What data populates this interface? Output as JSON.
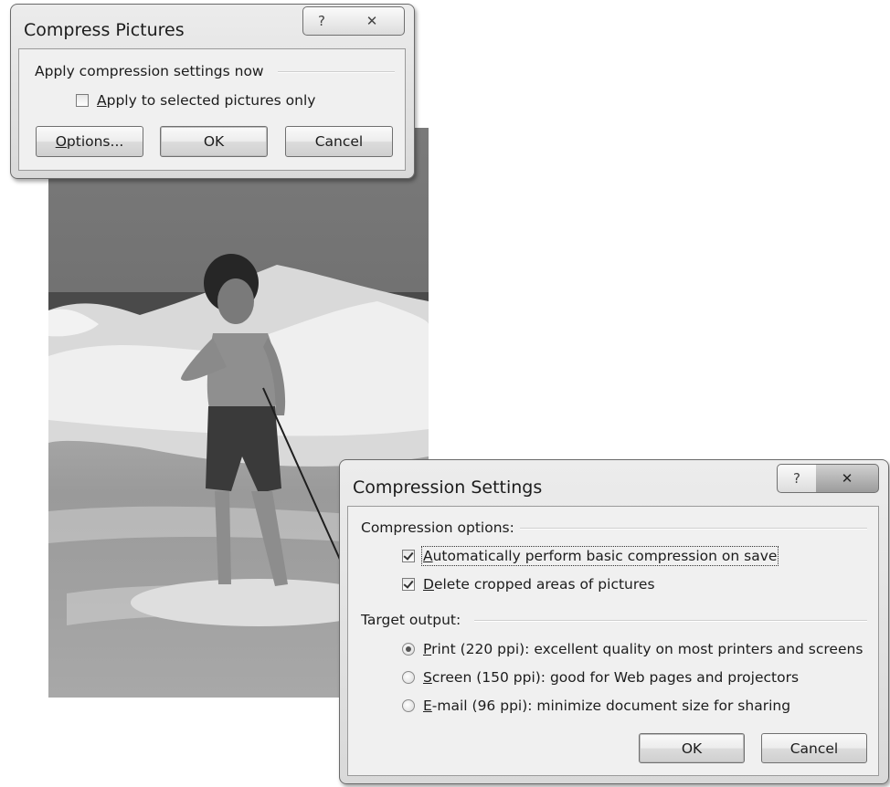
{
  "compress_pictures": {
    "title": "Compress Pictures",
    "help_icon": "question-mark-icon",
    "close_icon": "close-x-icon",
    "group_label": "Apply compression settings now",
    "apply_selected": {
      "label_prefix": "",
      "label_mnemonic": "A",
      "label_rest": "pply to selected pictures only",
      "checked": false
    },
    "buttons": {
      "options": {
        "mnemonic": "O",
        "rest": "ptions..."
      },
      "ok": "OK",
      "cancel": "Cancel"
    }
  },
  "compression_settings": {
    "title": "Compression Settings",
    "help_icon": "question-mark-icon",
    "close_icon": "close-x-icon",
    "options_label": "Compression options:",
    "auto_compress": {
      "mnemonic": "A",
      "rest": "utomatically perform basic compression on save",
      "checked": true
    },
    "delete_cropped": {
      "mnemonic": "D",
      "rest": "elete cropped areas of pictures",
      "checked": true
    },
    "target_label": "Target output:",
    "targets": [
      {
        "mnemonic": "P",
        "rest": "rint (220 ppi): excellent quality on most printers and screens",
        "selected": true
      },
      {
        "mnemonic": "S",
        "rest": "creen (150 ppi): good for Web pages and projectors",
        "selected": false
      },
      {
        "mnemonic": "E",
        "rest": "-mail (96 ppi): minimize document size for sharing",
        "selected": false
      }
    ],
    "buttons": {
      "ok": "OK",
      "cancel": "Cancel"
    }
  },
  "colors": {
    "dialog_face": "#f0f0f0",
    "border": "#6a6a6a",
    "photo_sky": "#6e6e6e",
    "photo_wave": "#e8e8e8"
  }
}
